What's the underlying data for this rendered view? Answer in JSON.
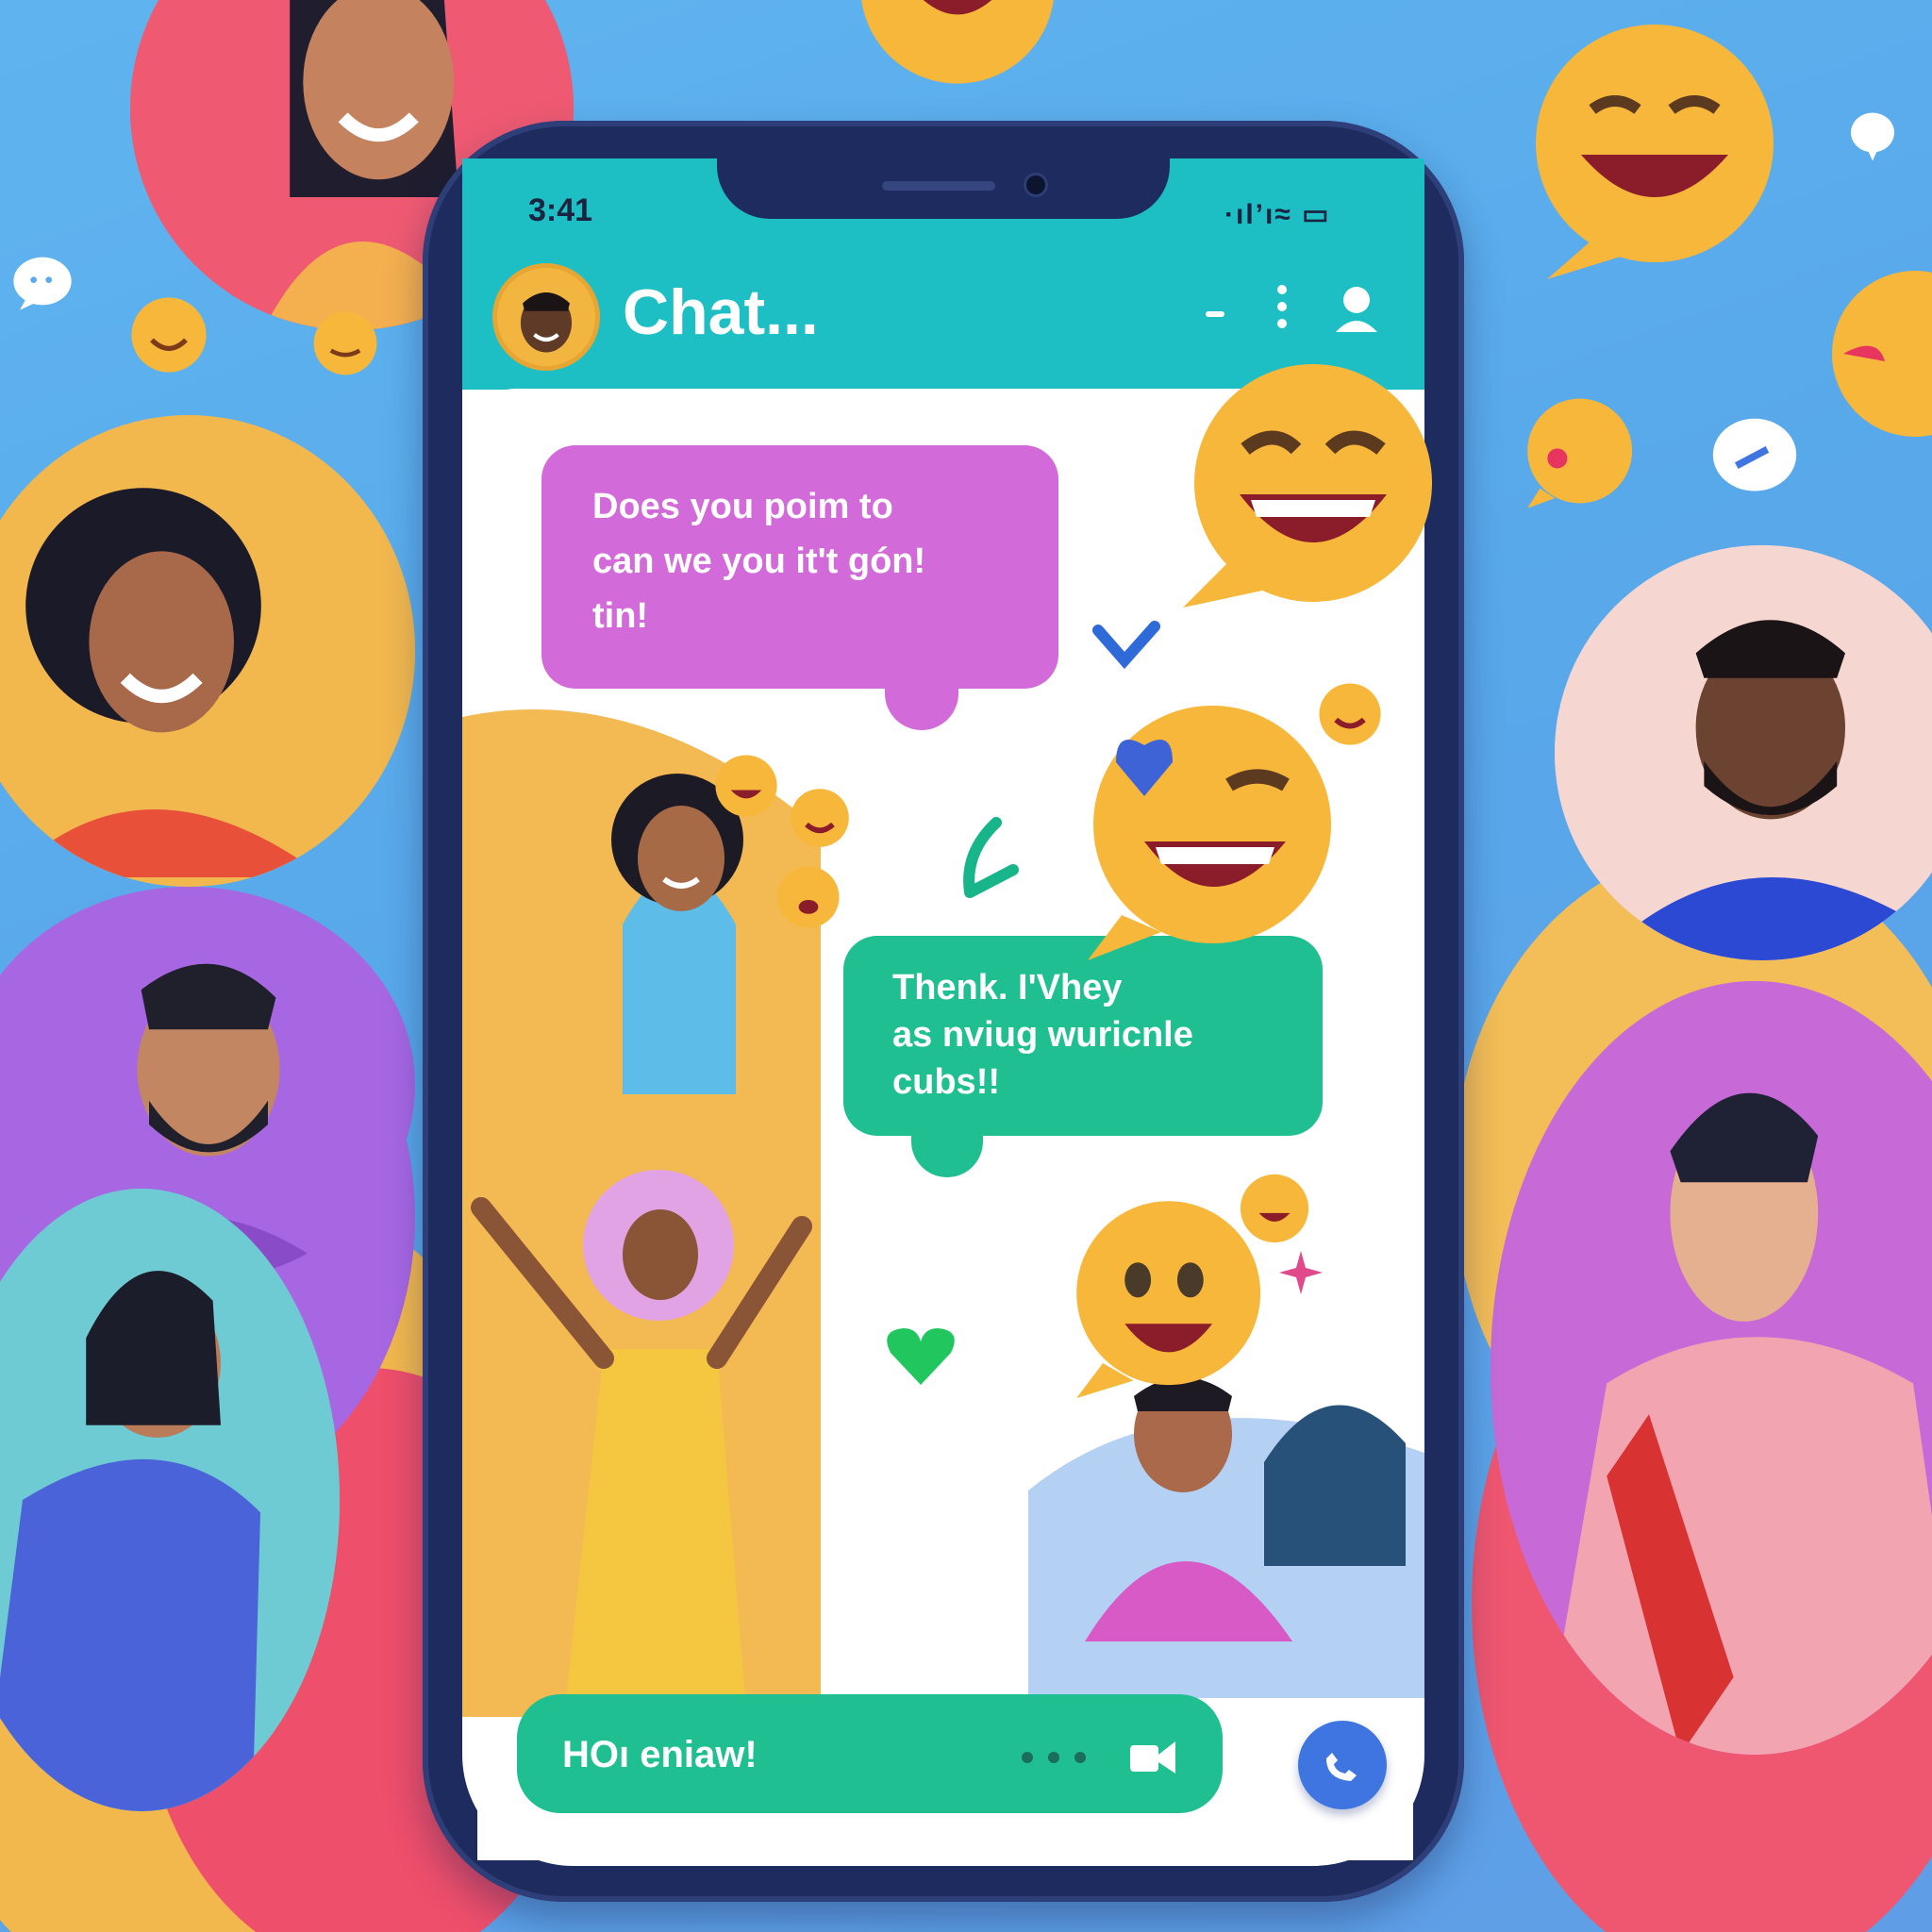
{
  "status_bar": {
    "time": "3:41",
    "icons": "·ıl’ı≈ ▭"
  },
  "header": {
    "title": "Chat...",
    "icons": [
      "minimize-icon",
      "more-vert-icon",
      "profile-icon"
    ]
  },
  "messages": [
    {
      "sender": "other",
      "text": "Does you poim to\ncan we you it't gón!\ntin!",
      "color": "#d36ad9"
    },
    {
      "sender": "other",
      "text": "Thenk. I'Vhey\nas nviug wuricnle\ncubs!!",
      "color": "#1fbf92"
    }
  ],
  "input": {
    "value": "HOı eniaw!",
    "color": "#1fbf92"
  },
  "actions": {
    "call_icon": "phone-call-icon"
  },
  "colors": {
    "header": "#1dbfc4",
    "background": "#5aaaeb",
    "accent_blue": "#3e75e0"
  }
}
